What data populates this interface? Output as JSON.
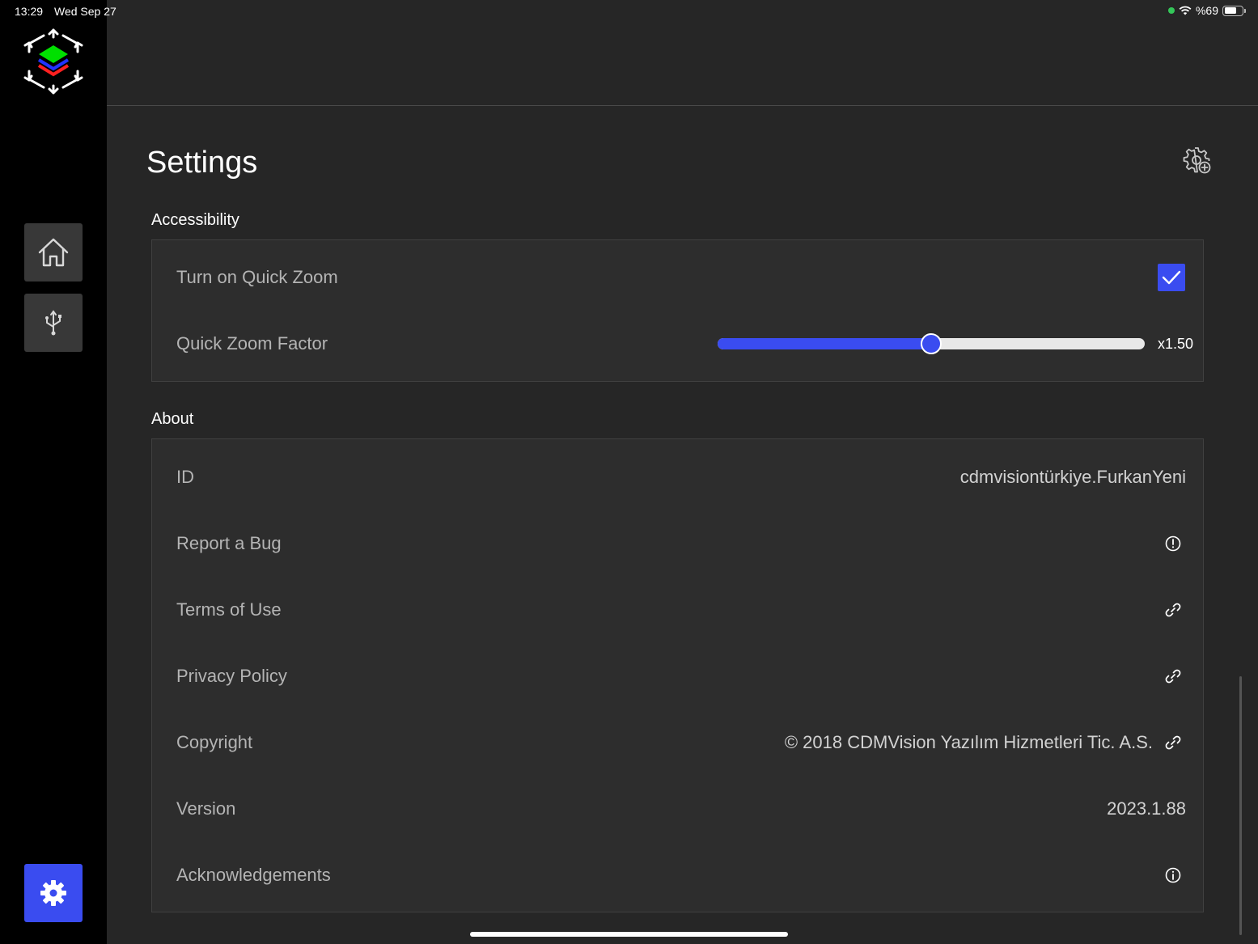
{
  "status_bar": {
    "time": "13:29",
    "date": "Wed Sep 27",
    "battery_text": "%69",
    "battery_level": 0.69
  },
  "sidebar": {
    "items": [
      {
        "name": "home",
        "icon": "home-icon"
      },
      {
        "name": "usb",
        "icon": "usb-icon"
      },
      {
        "name": "settings",
        "icon": "gear-icon",
        "active": true
      }
    ]
  },
  "page": {
    "title": "Settings",
    "header_icon": "gear-add-icon"
  },
  "accessibility": {
    "title": "Accessibility",
    "quick_zoom_label": "Turn on Quick Zoom",
    "quick_zoom_enabled": true,
    "zoom_factor_label": "Quick Zoom Factor",
    "zoom_factor_value": "x1.50",
    "zoom_factor_fraction": 0.5
  },
  "about": {
    "title": "About",
    "rows": [
      {
        "label": "ID",
        "value": "cdmvisiontürkiye.FurkanYeni",
        "icon": ""
      },
      {
        "label": "Report a Bug",
        "value": "",
        "icon": "alert-circle-icon"
      },
      {
        "label": "Terms of Use",
        "value": "",
        "icon": "link-icon"
      },
      {
        "label": "Privacy Policy",
        "value": "",
        "icon": "link-icon"
      },
      {
        "label": "Copyright",
        "value": "© 2018 CDMVision Yazılım Hizmetleri Tic. A.S.",
        "icon": "link-icon"
      },
      {
        "label": "Version",
        "value": "2023.1.88",
        "icon": ""
      },
      {
        "label": "Acknowledgements",
        "value": "",
        "icon": "info-circle-icon"
      }
    ]
  },
  "colors": {
    "accent": "#3a4cf0",
    "background": "#262626",
    "sidebar": "#000000",
    "card": "#2d2d2d"
  }
}
